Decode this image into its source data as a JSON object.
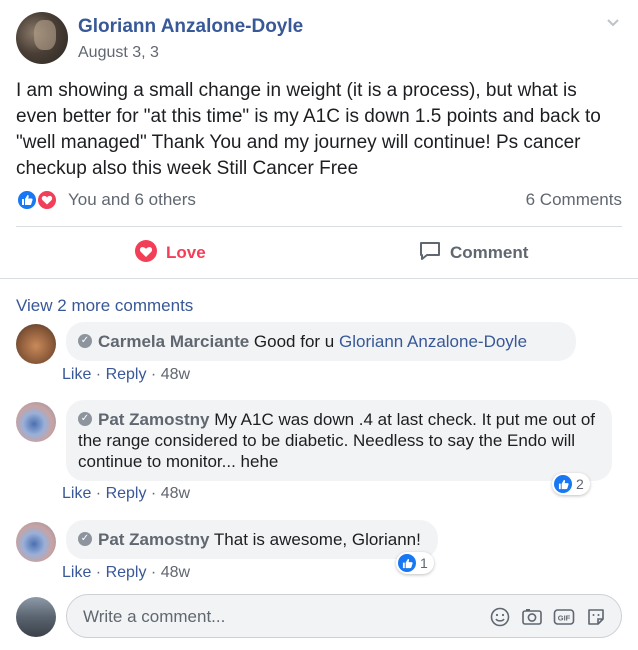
{
  "post": {
    "author": "Gloriann Anzalone-Doyle",
    "date": "August 3,        3",
    "text": "I am showing a small change in weight (it is a process), but what is even better for \"at this time\" is my A1C is down 1.5 points and back to \"well managed\" Thank You and my journey will continue! Ps cancer checkup also this week Still Cancer Free",
    "reactors": "You and 6 others",
    "comment_count": "6 Comments",
    "icons": [
      "like-reaction-icon",
      "love-reaction-icon",
      "chevron-down-icon"
    ]
  },
  "actions": {
    "love_label": "Love",
    "comment_label": "Comment",
    "love_color": "#f33e58"
  },
  "comments": {
    "view_more": "View 2 more comments",
    "items": [
      {
        "name": "Carmela Marciante",
        "text": "Good for u ",
        "mention": "Gloriann Anzalone-Doyle",
        "like": "Like",
        "reply": "Reply",
        "age": "48w"
      },
      {
        "name": "Pat Zamostny",
        "text": "My A1C was down .4 at last check. It put me out of the range considered to be diabetic. Needless to say the Endo will continue to monitor... hehe",
        "like": "Like",
        "reply": "Reply",
        "age": "48w",
        "reaction_count": "2"
      },
      {
        "name": "Pat Zamostny",
        "text": "That is awesome, Gloriann!",
        "like": "Like",
        "reply": "Reply",
        "age": "48w",
        "reaction_count": "1"
      }
    ]
  },
  "composer": {
    "placeholder": "Write a comment...",
    "icons": [
      "emoji-icon",
      "camera-icon",
      "gif-icon",
      "sticker-icon"
    ]
  },
  "colors": {
    "link": "#385898",
    "like_blue": "#1877f2",
    "love_red": "#f33e58",
    "secondary_text": "#606770",
    "bubble_bg": "#f2f3f5"
  }
}
